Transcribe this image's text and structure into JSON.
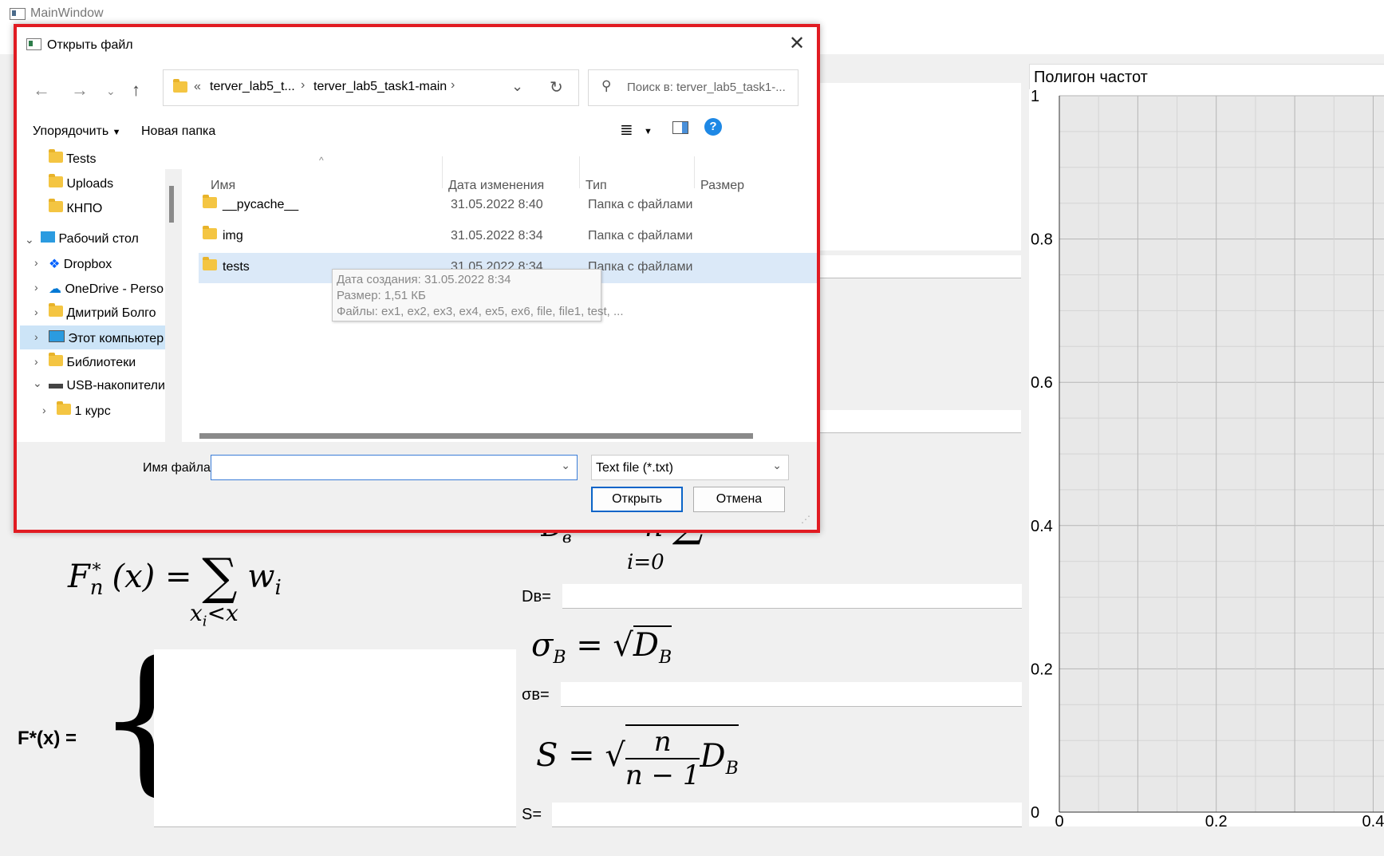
{
  "window": {
    "title": "MainWindow"
  },
  "main": {
    "label_db": "Dв=",
    "label_sigma": "σв=",
    "label_s": "S=",
    "label_fx": "F*(x) =",
    "formula_dispersion_fragment": "n ∑ (x_i − x̄_В)² n_i, i=0",
    "formula_fn": "F*_n(x) = ∑_{x_i<x} w_i",
    "formula_sigma": "σ_В = √D_В",
    "formula_s": "S = √(n/(n−1)) D_В"
  },
  "chart": {
    "title": "Полигон частот",
    "y_ticks": [
      "1",
      "0.8",
      "0.6",
      "0.4",
      "0.2",
      "0"
    ],
    "x_ticks": [
      "0",
      "0.2",
      "0.4"
    ]
  },
  "chart_data": {
    "type": "line",
    "title": "Полигон частот",
    "xlabel": "",
    "ylabel": "",
    "ylim": [
      0,
      1
    ],
    "xlim": [
      0,
      0.6
    ],
    "grid": true,
    "series": []
  },
  "dialog": {
    "title": "Открыть файл",
    "breadcrumb": [
      "«",
      "terver_lab5_t...",
      "terver_lab5_task1-main"
    ],
    "search_placeholder": "Поиск в: terver_lab5_task1-...",
    "toolbar": {
      "organize": "Упорядочить",
      "new_folder": "Новая папка"
    },
    "nav_items": [
      "Tests",
      "Uploads",
      "КНПО",
      "Рабочий стол",
      "Dropbox",
      "OneDrive - Perso",
      "Дмитрий Болго",
      "Этот компьютер",
      "Библиотеки",
      "USB-накопители",
      "1 курс"
    ],
    "columns": {
      "name": "Имя",
      "date": "Дата изменения",
      "type": "Тип",
      "size": "Размер"
    },
    "files": [
      {
        "name": "__pycache__",
        "date": "31.05.2022 8:40",
        "type": "Папка с файлами"
      },
      {
        "name": "img",
        "date": "31.05.2022 8:34",
        "type": "Папка с файлами"
      },
      {
        "name": "tests",
        "date": "31.05.2022 8:34",
        "type": "Папка с файлами"
      }
    ],
    "tooltip": {
      "created": "Дата создания: 31.05.2022 8:34",
      "size": "Размер: 1,51 КБ",
      "files": "Файлы: ex1, ex2, ex3, ex4, ex5, ex6, file, file1, test, ..."
    },
    "filename_label": "Имя файла:",
    "filename_value": "",
    "filter": "Text file (*.txt)",
    "open_button": "Открыть",
    "cancel_button": "Отмена",
    "colors": {
      "accent": "#0a64c8",
      "highlight_border": "#e11b22",
      "selection": "#dbe9f8"
    }
  }
}
